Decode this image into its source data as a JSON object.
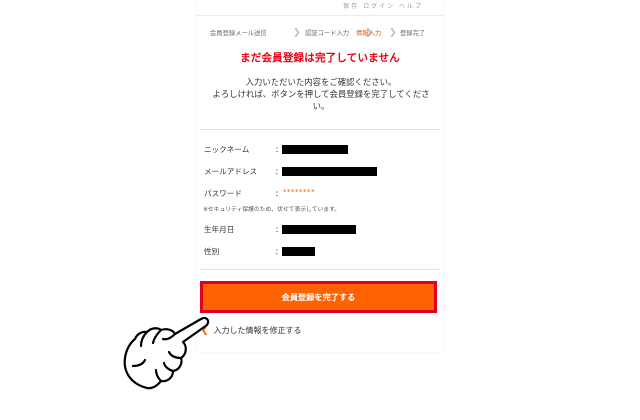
{
  "header": {
    "nav_text": "保存 ログイン ヘルプ"
  },
  "steps": [
    {
      "label": "会員登録メール送信",
      "active": false
    },
    {
      "label": "認証コード入力",
      "active": false
    },
    {
      "label": "情報入力",
      "active": true
    },
    {
      "label": "登録完了",
      "active": false
    }
  ],
  "headline": "まだ会員登録は完了していません",
  "description": {
    "line1": "入力いただいた内容をご確認ください。",
    "line2": "よろしければ、ボタンを押して会員登録を完了してくださ",
    "line3": "い。"
  },
  "fields": {
    "nickname": {
      "label": "ニックネーム",
      "colon": "："
    },
    "email": {
      "label": "メールアドレス",
      "colon": "："
    },
    "password": {
      "label": "パスワード",
      "colon": "：",
      "value": "********"
    },
    "password_note": "※セキュリティ保護のため、伏せて表示しています。",
    "birthday": {
      "label": "生年月日",
      "colon": "："
    },
    "gender": {
      "label": "性別",
      "colon": "："
    }
  },
  "actions": {
    "submit_label": "会員登録を完了する",
    "back_label": "入力した情報を修正する"
  },
  "colors": {
    "accent": "#ff6200",
    "alert": "#e60012",
    "border_highlight": "#e0001f"
  }
}
